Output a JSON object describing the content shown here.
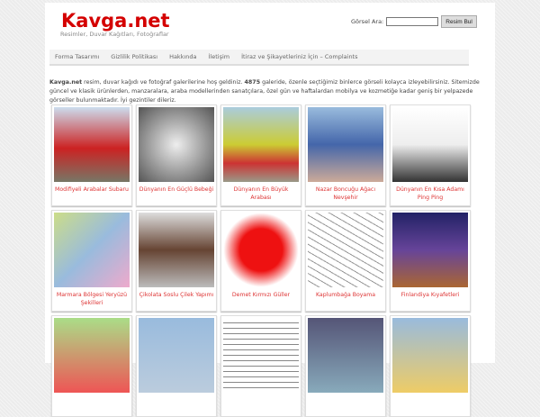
{
  "site": {
    "title": "Kavga.net",
    "tagline": "Resimler, Duvar Kağıtları, Fotoğraflar"
  },
  "search": {
    "label": "Görsel Ara:",
    "value": "",
    "button": "Resim Bul"
  },
  "nav": [
    "Forma Tasarımı",
    "Gizlilik Politikası",
    "Hakkında",
    "İletişim",
    "İtiraz ve Şikayetleriniz İçin – Complaints"
  ],
  "intro": {
    "brand": "Kavga.net",
    "text1": " resim, duvar kağıdı ve fotoğraf galerilerine hoş geldiniz. ",
    "count": "4875",
    "text2": " galeride, özenle seçtiğimiz binlerce görseli kolayca izleyebilirsiniz. Sitemizde güncel ve klasik ürünlerden, manzaralara, araba modellerinden sanatçılara, özel gün ve haftalardan mobilya ve kozmetiğe kadar geniş bir yelpazede görseller bulunmaktadır. İyi gezintiler dileriz."
  },
  "galleries": [
    {
      "caption": "Modifiyeli Arabalar Subaru",
      "color": "linear-gradient(#cde,#c22 55%,#776)"
    },
    {
      "caption": "Dünyanın En Güçlü Bebeği",
      "color": "radial-gradient(#eee,#555)"
    },
    {
      "caption": "Dünyanın En Büyük Arabası",
      "color": "linear-gradient(#acd,#cc3 50%,#c33 75%,#998)"
    },
    {
      "caption": "Nazar Boncuğu Ağacı Nevşehir",
      "color": "linear-gradient(#9bd,#46a 50%,#ca9)"
    },
    {
      "caption": "Dünyanın En Kısa Adamı Ping Ping",
      "color": "linear-gradient(#fff,#eee 50%,#333)"
    },
    {
      "caption": "Marmara Bölgesi Yeryüzü Şekilleri",
      "color": "linear-gradient(135deg,#cd8,#9bd 50%,#eac)"
    },
    {
      "caption": "Çikolata Soslu Çilek Yapımı",
      "color": "linear-gradient(#ddd,#643 50%,#bbb)"
    },
    {
      "caption": "Demet Kırmızı Güller",
      "color": "radial-gradient(#e11 40%,#fff 70%)"
    },
    {
      "caption": "Kaplumbağa Boyama",
      "color": "repeating-linear-gradient(30deg,#fff 0 6px,#999 6px 7px)"
    },
    {
      "caption": "Finlandiya Kıyafetleri",
      "color": "linear-gradient(#226,#649 50%,#a63)"
    },
    {
      "caption": "",
      "color": "linear-gradient(#ad8,#e55)"
    },
    {
      "caption": "",
      "color": "linear-gradient(#9bd,#bcd)"
    },
    {
      "caption": "",
      "color": "repeating-linear-gradient(#fff 0 5px,#888 5px 6px)"
    },
    {
      "caption": "",
      "color": "linear-gradient(#557,#8ab)"
    },
    {
      "caption": "",
      "color": "linear-gradient(#9bd,#ec6)"
    }
  ]
}
